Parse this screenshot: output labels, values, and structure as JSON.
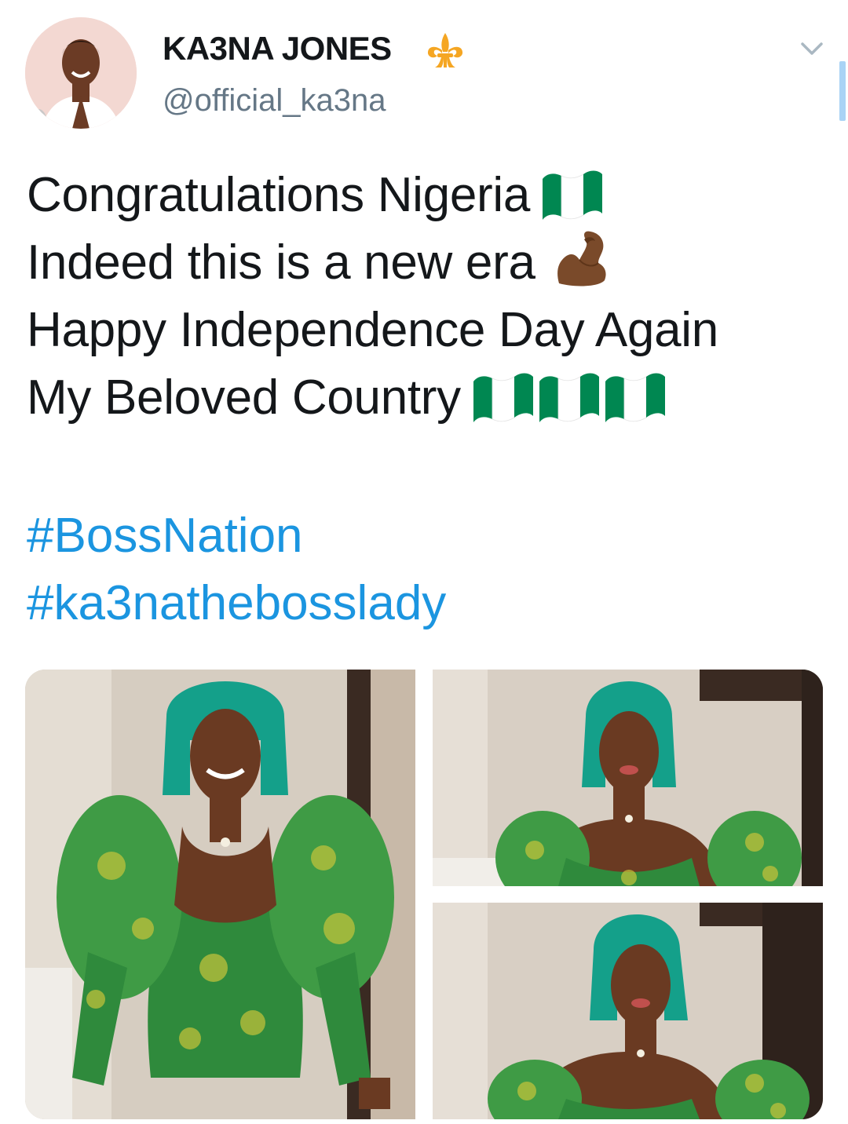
{
  "tweet": {
    "author": {
      "display_name": "KA3NA JONES",
      "handle": "@official_ka3na",
      "avatar_icon": "avatar-photo",
      "badge_icon": "fleur-de-lis-icon",
      "badge_color": "#f5a623"
    },
    "menu_icon": "chevron-down-icon",
    "text_lines": [
      "Congratulations Nigeria",
      "Indeed this is a new era",
      "Happy Independence Day Again",
      "My Beloved Country"
    ],
    "emojis": {
      "line1": [
        "nigeria-flag"
      ],
      "line2": [
        "flexed-biceps"
      ],
      "line4": [
        "nigeria-flag",
        "nigeria-flag",
        "nigeria-flag"
      ]
    },
    "hashtags": [
      "#BossNation",
      "#ka3natheboss​lady"
    ],
    "media": [
      {
        "kind": "photo"
      },
      {
        "kind": "photo"
      },
      {
        "kind": "photo"
      }
    ]
  },
  "colors": {
    "text": "#14171a",
    "secondary": "#657786",
    "link": "#1b95e0",
    "flag_green": "#008751",
    "flag_white": "#ffffff"
  }
}
